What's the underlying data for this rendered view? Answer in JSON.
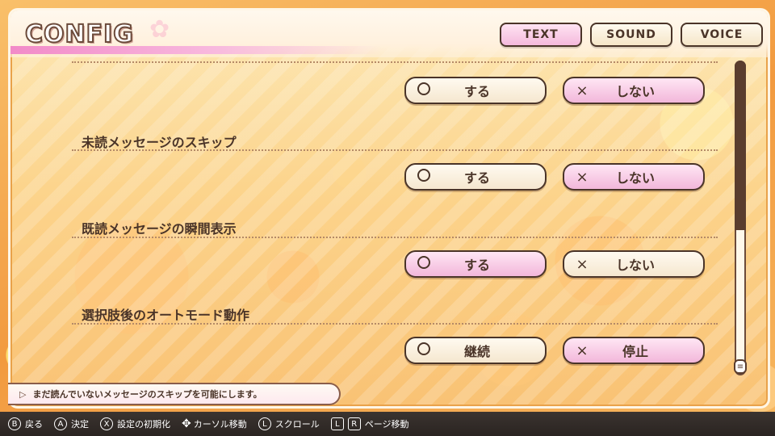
{
  "header": {
    "title": "CONFIG",
    "tabs": [
      {
        "label": "TEXT",
        "active": true
      },
      {
        "label": "SOUND",
        "active": false
      },
      {
        "label": "VOICE",
        "active": false
      }
    ]
  },
  "settings": [
    {
      "label": "",
      "options": [
        {
          "mark": "○",
          "text": "する",
          "selected": false
        },
        {
          "mark": "×",
          "text": "しない",
          "selected": true
        }
      ]
    },
    {
      "label": "未読メッセージのスキップ",
      "options": [
        {
          "mark": "○",
          "text": "する",
          "selected": false
        },
        {
          "mark": "×",
          "text": "しない",
          "selected": true
        }
      ]
    },
    {
      "label": "既読メッセージの瞬間表示",
      "options": [
        {
          "mark": "○",
          "text": "する",
          "selected": true
        },
        {
          "mark": "×",
          "text": "しない",
          "selected": false
        }
      ]
    },
    {
      "label": "選択肢後のオートモード動作",
      "options": [
        {
          "mark": "○",
          "text": "継続",
          "selected": false
        },
        {
          "mark": "×",
          "text": "停止",
          "selected": true
        }
      ]
    }
  ],
  "hint": {
    "text": "まだ読んでいないメッセージのスキップを可能にします。"
  },
  "scrollbar": {
    "position": 1.0
  },
  "footer": [
    {
      "key": "B",
      "label": "戻る",
      "icon": "b-button-icon"
    },
    {
      "key": "A",
      "label": "決定",
      "icon": "a-button-icon"
    },
    {
      "key": "X",
      "label": "設定の初期化",
      "icon": "x-button-icon"
    },
    {
      "key": "",
      "label": "カーソル移動",
      "icon": "dpad-icon"
    },
    {
      "key": "L",
      "label": "スクロール",
      "icon": "l-stick-icon"
    },
    {
      "key": "L",
      "key2": "R",
      "label": "ページ移動",
      "icon": "lr-button-icon"
    }
  ],
  "colors": {
    "accent_pink": "#f2b7da",
    "text_brown": "#4a3428",
    "panel_cream": "#fde8b6"
  }
}
